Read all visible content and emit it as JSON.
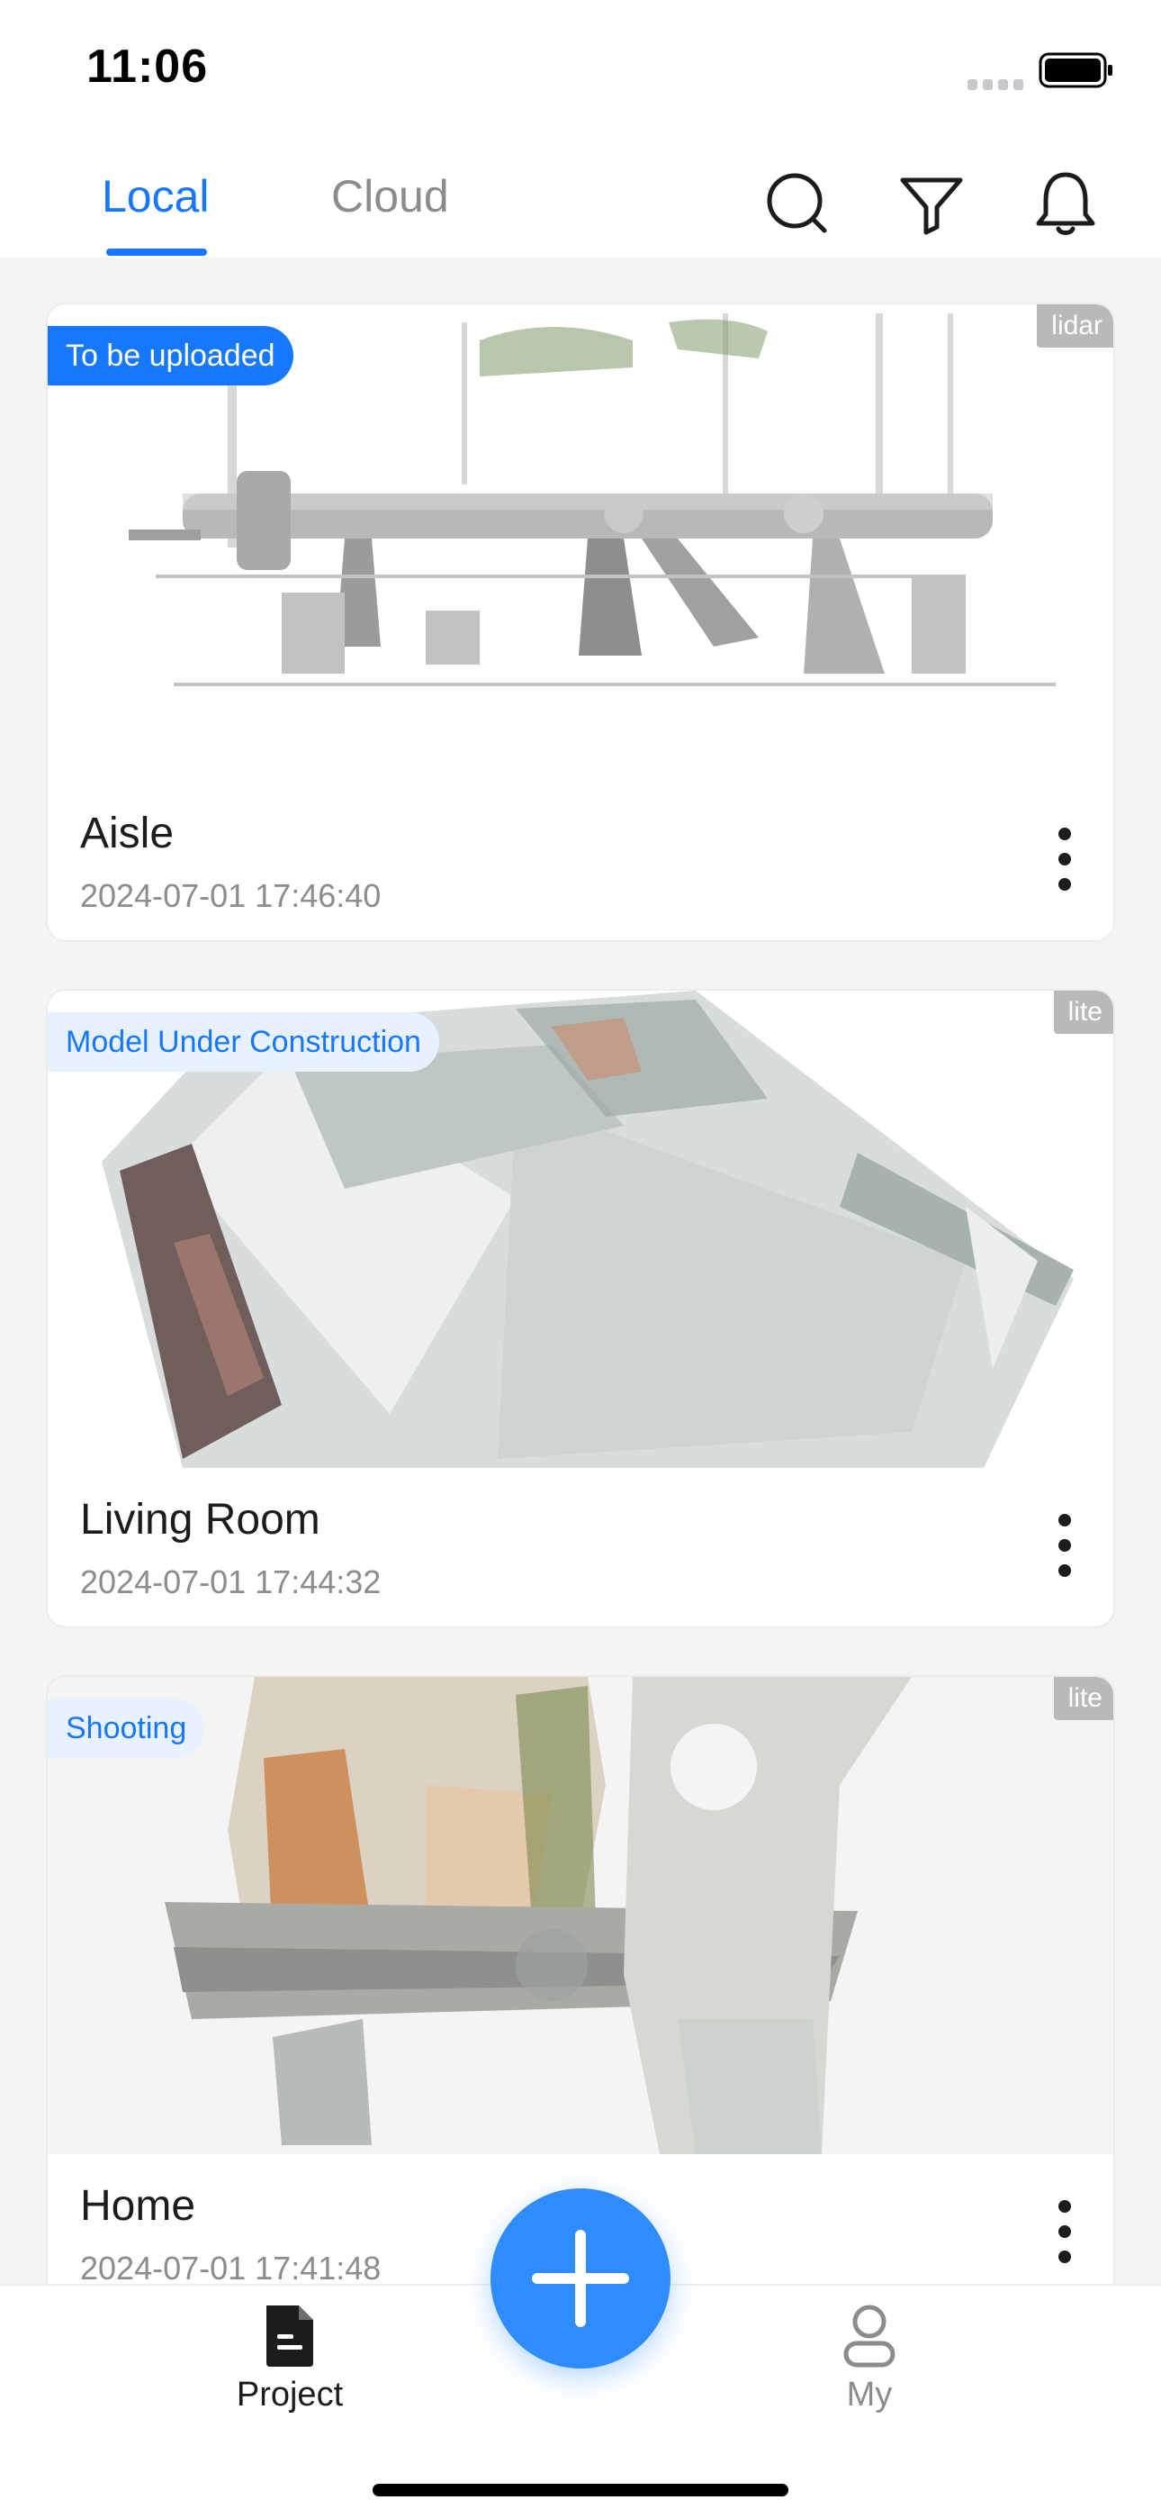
{
  "status_bar": {
    "time": "11:06"
  },
  "header": {
    "tabs": [
      {
        "label": "Local",
        "active": true
      },
      {
        "label": "Cloud",
        "active": false
      }
    ],
    "icons": [
      "search-icon",
      "filter-icon",
      "bell-icon"
    ]
  },
  "projects": [
    {
      "title": "Aisle",
      "date": "2024-07-01 17:46:40",
      "status": "To be uploaded",
      "status_style": "solid",
      "sensor": "lidar"
    },
    {
      "title": "Living Room",
      "date": "2024-07-01 17:44:32",
      "status": "Model Under Construction",
      "status_style": "soft",
      "sensor": "lite"
    },
    {
      "title": "Home",
      "date": "2024-07-01 17:41:48",
      "status": "Shooting",
      "status_style": "soft",
      "sensor": "lite"
    }
  ],
  "tabbar": {
    "items": [
      {
        "label": "Project",
        "icon": "document-icon",
        "active": true
      },
      {
        "label": "My",
        "icon": "user-icon",
        "active": false
      }
    ],
    "fab_icon": "plus-icon"
  },
  "colors": {
    "accent": "#1677ff",
    "fab": "#2f8cff",
    "muted": "#8c8c8c",
    "sensor_tag": "#b9b9b9"
  }
}
